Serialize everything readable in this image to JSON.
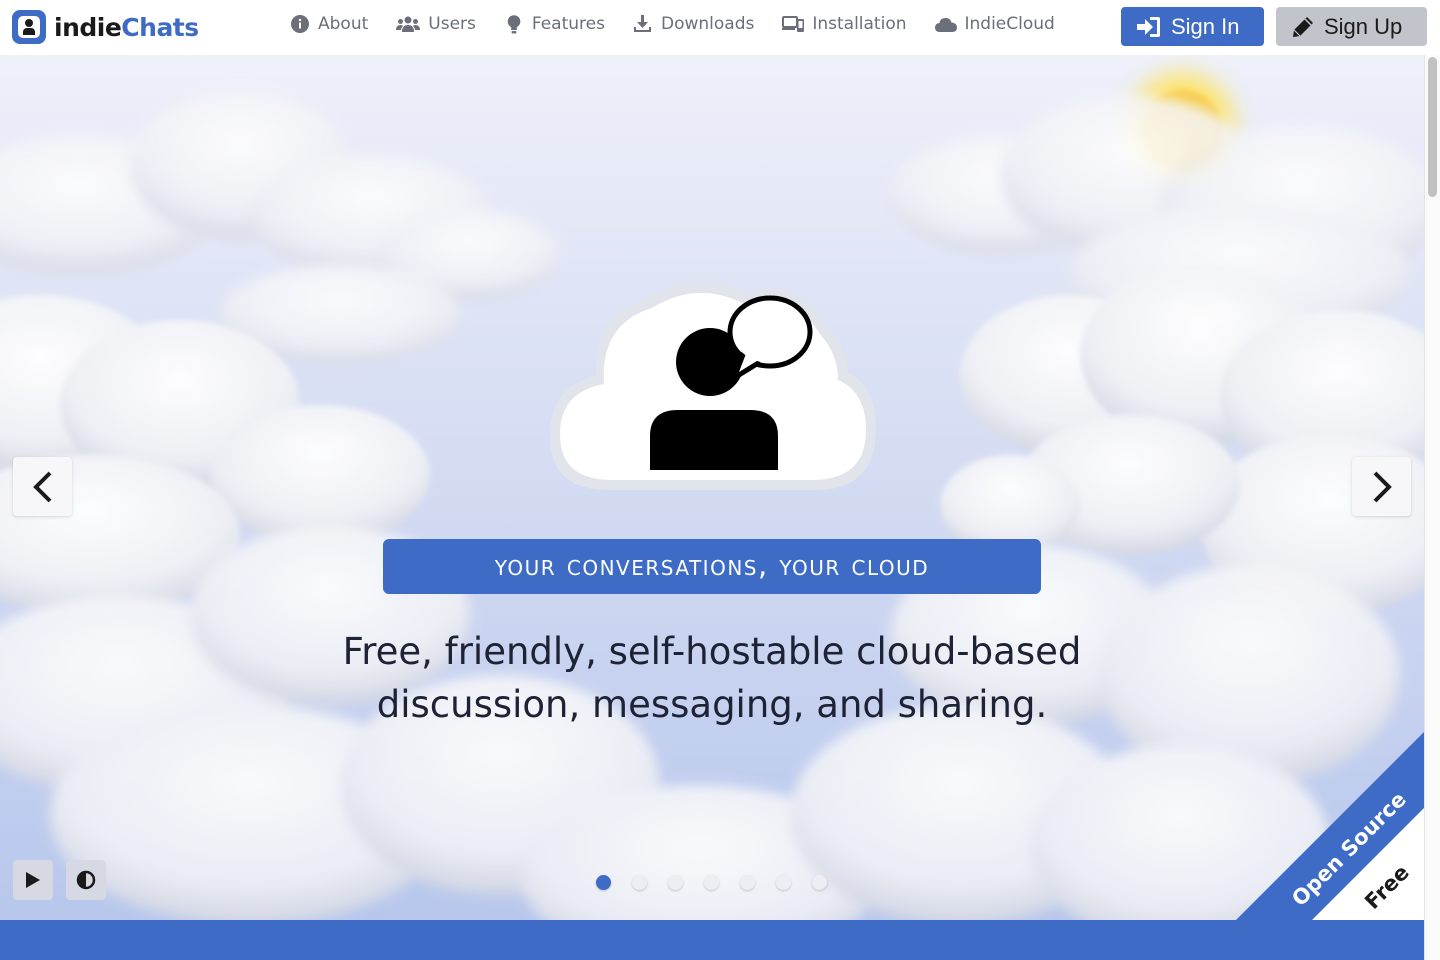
{
  "brand": {
    "name_part1": "indie",
    "name_part2": "Chats",
    "accent_color": "#3d6bc6"
  },
  "nav": [
    {
      "label": "About",
      "icon": "info-circle-icon"
    },
    {
      "label": "Users",
      "icon": "users-icon"
    },
    {
      "label": "Features",
      "icon": "lightbulb-icon"
    },
    {
      "label": "Downloads",
      "icon": "download-icon"
    },
    {
      "label": "Installation",
      "icon": "devices-icon"
    },
    {
      "label": "IndieCloud",
      "icon": "cloud-icon"
    }
  ],
  "auth": {
    "sign_in": "Sign In",
    "sign_up": "Sign Up"
  },
  "hero": {
    "tagline": "Your conversations, your cloud",
    "subtitle_line1": "Free, friendly, self-hostable cloud-based",
    "subtitle_line2": "discussion, messaging, and sharing.",
    "slide_count": 7,
    "active_slide": 1
  },
  "ribbon": {
    "line1": "Open Source",
    "line2": "Free"
  }
}
